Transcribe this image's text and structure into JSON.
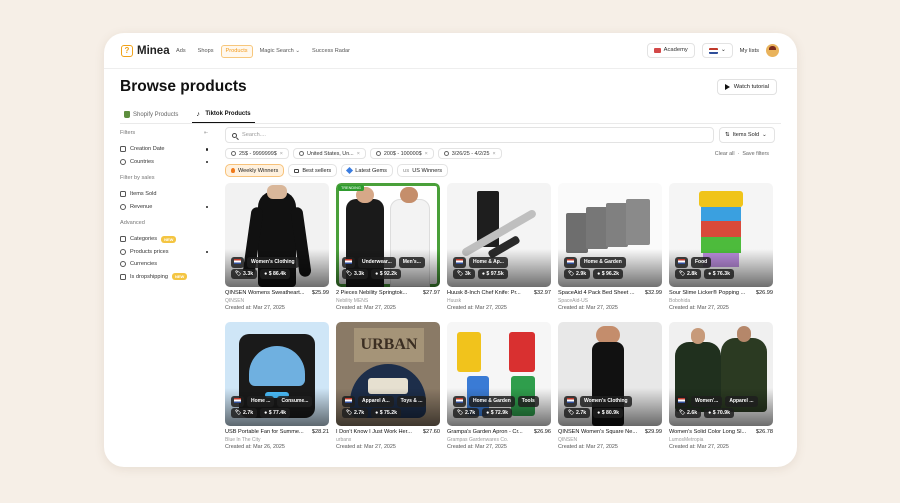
{
  "app": {
    "name": "Minea",
    "logo_glyph": "?"
  },
  "nav": {
    "links": [
      "Ads",
      "Shops",
      "Products",
      "Magic Search ⌄",
      "Success Radar"
    ],
    "active": "Products",
    "academy": "Academy",
    "my_lists": "My lists"
  },
  "page": {
    "title": "Browse products",
    "tutorial": "Watch tutorial",
    "tabs": [
      "Shopify Products",
      "Tiktok Products"
    ],
    "active_tab": "Tiktok Products"
  },
  "sidebar": {
    "filters_head": "Filters",
    "filters": [
      "Creation Date",
      "Countries"
    ],
    "sales_head": "Filter by sales",
    "sales": [
      "Items Sold",
      "Revenue"
    ],
    "adv_head": "Advanced",
    "adv": [
      "Categories",
      "Products prices",
      "Currencies",
      "Is dropshipping"
    ],
    "new_badge": "NEW"
  },
  "search": {
    "placeholder": "Search....",
    "sort": "Items Sold"
  },
  "chips": [
    "25$ - 9999999$",
    "United States, Un...",
    "200$ - 100000$",
    "3/26/25 - 4/2/25"
  ],
  "filter_actions": {
    "clear": "Clear all",
    "save": "Save filters",
    "sep": "·"
  },
  "quick": [
    "Weekly Winners",
    "Best sellers",
    "Latest Gems",
    "US Winners"
  ],
  "us_flag_text": "US",
  "products": [
    {
      "cats": [
        "Women's Clothing"
      ],
      "sold": "3.3k",
      "rev": "$ 86.4k",
      "title": "QINSEN Womens Sweatheart...",
      "price": "$25.99",
      "shop": "QINSEN",
      "date": "Created at: Mar 27, 2025"
    },
    {
      "cats": [
        "Underwear...",
        "Men's..."
      ],
      "sold": "3.3k",
      "rev": "$ 92.2k",
      "title": "2 Pieces Nebility Springtok...",
      "price": "$27.97",
      "shop": "Nebility MENS",
      "date": "Created at: Mar 27, 2025",
      "hot": "TRENDING"
    },
    {
      "cats": [
        "Home & Ap..."
      ],
      "sold": "3k",
      "rev": "$ 97.5k",
      "title": "Huusk 8-Inch Chef Knife: Pr...",
      "price": "$32.97",
      "shop": "Huusk",
      "date": "Created at: Mar 27, 2025"
    },
    {
      "cats": [
        "Home & Garden"
      ],
      "sold": "2.9k",
      "rev": "$ 96.2k",
      "title": "SpaceAid 4 Pack Bed Sheet ...",
      "price": "$32.99",
      "shop": "SpaceAid-US",
      "date": "Created at: Mar 27, 2025"
    },
    {
      "cats": [
        "Food"
      ],
      "sold": "2.8k",
      "rev": "$ 76.3k",
      "title": "Sour Slime Licker® Popping ...",
      "price": "$26.99",
      "shop": "Bobohida",
      "date": "Created at: Mar 27, 2025"
    },
    {
      "cats": [
        "Home ...",
        "Consume..."
      ],
      "sold": "2.7k",
      "rev": "$ 77.4k",
      "title": "USB Portable Fan for Summe...",
      "price": "$28.21",
      "shop": "Blue In The City",
      "date": "Created at: Mar 26, 2025"
    },
    {
      "cats": [
        "Apparel A...",
        "Toys & ..."
      ],
      "sold": "2.7k",
      "rev": "$ 75.2k",
      "title": "I Don't Know I Just Work Her...",
      "price": "$27.60",
      "shop": "urbanx",
      "date": "Created at: Mar 27, 2025"
    },
    {
      "cats": [
        "Home & Garden",
        "Tools"
      ],
      "sold": "2.7k",
      "rev": "$ 72.9k",
      "title": "Grampa's Garden Apron - Cr...",
      "price": "$26.96",
      "shop": "Grampas Gardenwares Co.",
      "date": "Created at: Mar 27, 2025"
    },
    {
      "cats": [
        "Women's Clothing"
      ],
      "sold": "2.7k",
      "rev": "$ 80.9k",
      "title": "QINSEN Women's Square Ne...",
      "price": "$29.99",
      "shop": "QINSEN",
      "date": "Created at: Mar 27, 2025"
    },
    {
      "cats": [
        "Women'...",
        "Apparel ..."
      ],
      "sold": "2.6k",
      "rev": "$ 70.9k",
      "title": "Women's Solid Color Long Sl...",
      "price": "$26.78",
      "shop": "LumosMetropia",
      "date": "Created at: Mar 27, 2025"
    }
  ],
  "colors": {
    "accent": "#f39a1a",
    "background": "#f6efe7"
  }
}
